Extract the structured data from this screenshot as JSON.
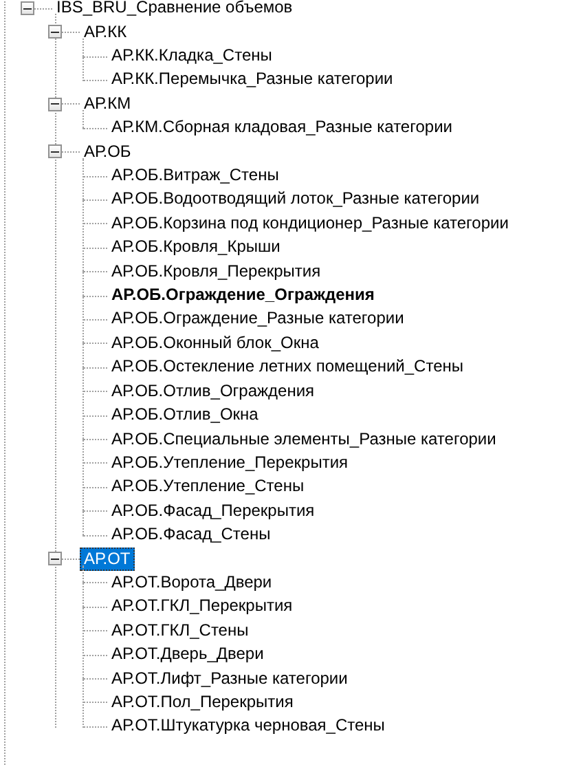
{
  "tree": [
    {
      "label": "IBS_BRU_Сравнение объемов",
      "expanded": true,
      "selected": false,
      "bold": false,
      "children": [
        {
          "label": "АР.КК",
          "expanded": true,
          "selected": false,
          "bold": false,
          "children": [
            {
              "label": "АР.КК.Кладка_Стены",
              "selected": false,
              "bold": false
            },
            {
              "label": "АР.КК.Перемычка_Разные категории",
              "selected": false,
              "bold": false
            }
          ]
        },
        {
          "label": "АР.КМ",
          "expanded": true,
          "selected": false,
          "bold": false,
          "children": [
            {
              "label": "АР.КМ.Сборная кладовая_Разные категории",
              "selected": false,
              "bold": false
            }
          ]
        },
        {
          "label": "АР.ОБ",
          "expanded": true,
          "selected": false,
          "bold": false,
          "children": [
            {
              "label": "АР.ОБ.Витраж_Стены",
              "selected": false,
              "bold": false
            },
            {
              "label": "АР.ОБ.Водоотводящий лоток_Разные категории",
              "selected": false,
              "bold": false
            },
            {
              "label": "АР.ОБ.Корзина под кондиционер_Разные категории",
              "selected": false,
              "bold": false
            },
            {
              "label": "АР.ОБ.Кровля_Крыши",
              "selected": false,
              "bold": false
            },
            {
              "label": "АР.ОБ.Кровля_Перекрытия",
              "selected": false,
              "bold": false
            },
            {
              "label": "АР.ОБ.Ограждение_Ограждения",
              "selected": false,
              "bold": true
            },
            {
              "label": "АР.ОБ.Ограждение_Разные категории",
              "selected": false,
              "bold": false
            },
            {
              "label": "АР.ОБ.Оконный блок_Окна",
              "selected": false,
              "bold": false
            },
            {
              "label": "АР.ОБ.Остекление летних помещений_Стены",
              "selected": false,
              "bold": false
            },
            {
              "label": "АР.ОБ.Отлив_Ограждения",
              "selected": false,
              "bold": false
            },
            {
              "label": "АР.ОБ.Отлив_Окна",
              "selected": false,
              "bold": false
            },
            {
              "label": "АР.ОБ.Специальные элементы_Разные категории",
              "selected": false,
              "bold": false
            },
            {
              "label": "АР.ОБ.Утепление_Перекрытия",
              "selected": false,
              "bold": false
            },
            {
              "label": "АР.ОБ.Утепление_Стены",
              "selected": false,
              "bold": false
            },
            {
              "label": "АР.ОБ.Фасад_Перекрытия",
              "selected": false,
              "bold": false
            },
            {
              "label": "АР.ОБ.Фасад_Стены",
              "selected": false,
              "bold": false
            }
          ]
        },
        {
          "label": "АР.ОТ",
          "expanded": true,
          "selected": true,
          "bold": false,
          "children": [
            {
              "label": "АР.ОТ.Ворота_Двери",
              "selected": false,
              "bold": false
            },
            {
              "label": "АР.ОТ.ГКЛ_Перекрытия",
              "selected": false,
              "bold": false
            },
            {
              "label": "АР.ОТ.ГКЛ_Стены",
              "selected": false,
              "bold": false
            },
            {
              "label": "АР.ОТ.Дверь_Двери",
              "selected": false,
              "bold": false
            },
            {
              "label": "АР.ОТ.Лифт_Разные категории",
              "selected": false,
              "bold": false
            },
            {
              "label": "АР.ОТ.Пол_Перекрытия",
              "selected": false,
              "bold": false
            },
            {
              "label": "АР.ОТ.Штукатурка черновая_Стены",
              "selected": false,
              "bold": false
            }
          ]
        }
      ]
    }
  ]
}
